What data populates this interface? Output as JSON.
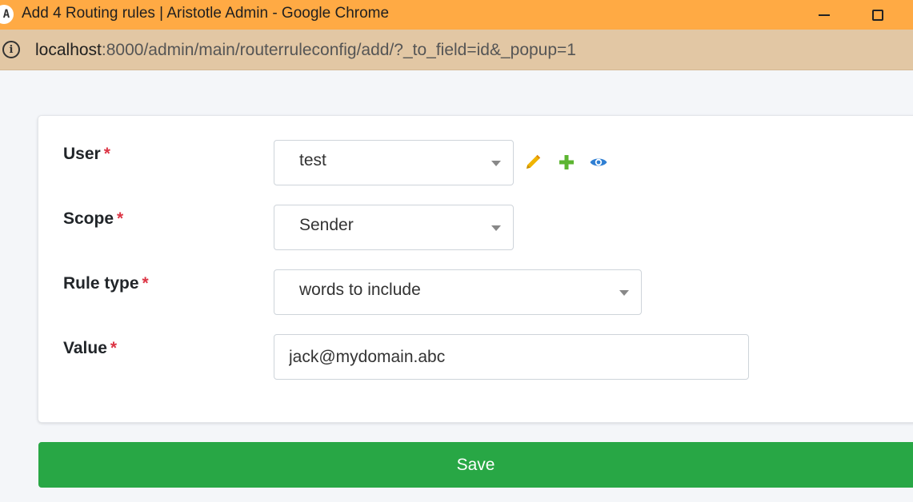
{
  "window": {
    "title": "Add 4 Routing rules | Aristotle Admin - Google Chrome",
    "icon_letter": "A"
  },
  "address_bar": {
    "host": "localhost",
    "path": ":8000/admin/main/routerruleconfig/add/?_to_field=id&_popup=1"
  },
  "form": {
    "user": {
      "label": "User",
      "required_mark": "*",
      "value": "test"
    },
    "scope": {
      "label": "Scope",
      "required_mark": "*",
      "value": "Sender"
    },
    "rule_type": {
      "label": "Rule type",
      "required_mark": "*",
      "value": "words to include"
    },
    "value": {
      "label": "Value",
      "required_mark": "*",
      "value": "jack@mydomain.abc"
    },
    "related_icons": [
      "pencil-icon",
      "plus-icon",
      "eye-icon"
    ]
  },
  "save_label": "Save",
  "colors": {
    "titlebar": "#ffaa44",
    "addressbar": "#e2c7a4",
    "save_button": "#28a745",
    "required": "#dc3545",
    "edit_icon": "#f0b400",
    "add_icon": "#5cb531",
    "view_icon": "#2f7fd3"
  }
}
